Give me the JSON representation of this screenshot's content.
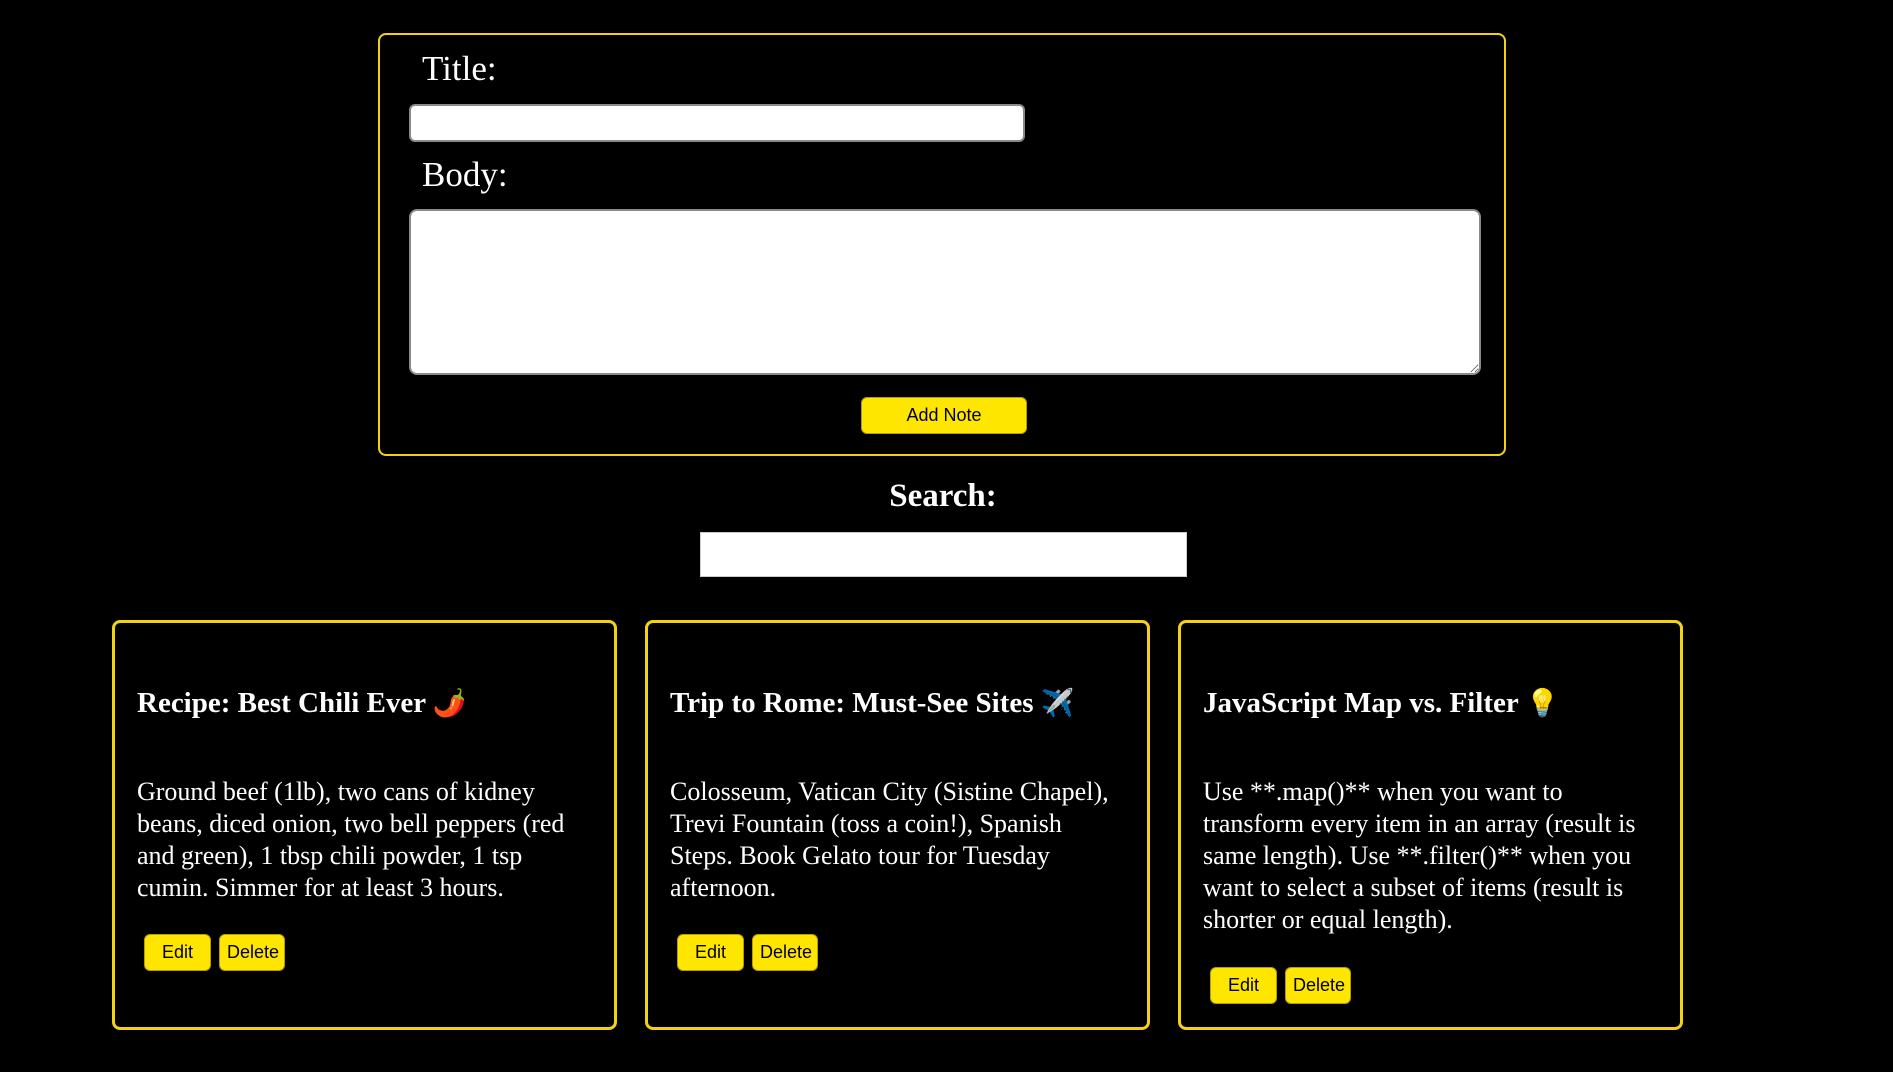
{
  "form": {
    "title_label": "Title:",
    "title_value": "",
    "body_label": "Body:",
    "body_value": "",
    "add_label": "Add Note"
  },
  "search": {
    "heading": "Search:",
    "value": ""
  },
  "notes": [
    {
      "title": "Recipe: Best Chili Ever",
      "emoji": "🌶️",
      "body": "Ground beef (1lb), two cans of kidney beans, diced onion, two bell peppers (red and green), 1 tbsp chili powder, 1 tsp cumin. Simmer for at least 3 hours.",
      "edit_label": "Edit",
      "delete_label": "Delete"
    },
    {
      "title": "Trip to Rome: Must-See Sites",
      "emoji": "✈️",
      "body": "Colosseum, Vatican City (Sistine Chapel), Trevi Fountain (toss a coin!), Spanish Steps. Book Gelato tour for Tuesday afternoon.",
      "edit_label": "Edit",
      "delete_label": "Delete"
    },
    {
      "title": "JavaScript Map vs. Filter",
      "emoji": "💡",
      "body": "Use **.map()** when you want to transform every item in an array (result is same length). Use **.filter()** when you want to select a subset of items (result is shorter or equal length).",
      "edit_label": "Edit",
      "delete_label": "Delete"
    }
  ],
  "colors": {
    "background": "#000000",
    "accent_border": "#f5d211",
    "button_fill": "#ffe600",
    "text": "#ffffff"
  }
}
